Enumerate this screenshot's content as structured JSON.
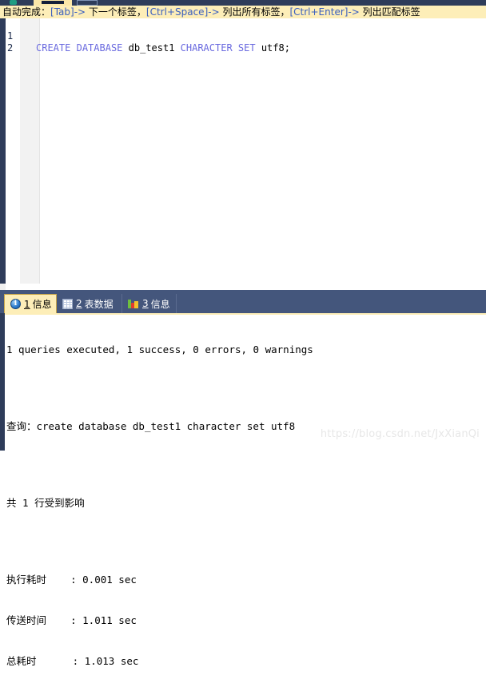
{
  "toolbar": {
    "icon_plus": "plus-green-icon",
    "tab_active_label": "",
    "box_label": ""
  },
  "hint_bar": {
    "prefix": "自动完成：",
    "items": [
      {
        "key": "[Tab]->",
        "text": " 下一个标签，"
      },
      {
        "key": "[Ctrl+Space]->",
        "text": " 列出所有标签，"
      },
      {
        "key": "[Ctrl+Enter]->",
        "text": " 列出匹配标签"
      }
    ],
    "key_color": "#3a5fbf"
  },
  "editor": {
    "lines": [
      {
        "number": "1",
        "tokens": [
          {
            "text": "CREATE",
            "type": "keyword"
          },
          {
            "text": " ",
            "type": "plain"
          },
          {
            "text": "DATABASE",
            "type": "keyword"
          },
          {
            "text": " db_test1 ",
            "type": "plain"
          },
          {
            "text": "CHARACTER",
            "type": "keyword"
          },
          {
            "text": " ",
            "type": "plain"
          },
          {
            "text": "SET",
            "type": "keyword"
          },
          {
            "text": " utf8;",
            "type": "plain"
          }
        ]
      },
      {
        "number": "2",
        "tokens": []
      }
    ],
    "keyword_color": "#6a6adf",
    "text_color": "#000000"
  },
  "result_tabs": [
    {
      "num": "1",
      "label": "信息",
      "icon": "info-icon",
      "active": true
    },
    {
      "num": "2",
      "label": "表数据",
      "icon": "table-grid-icon",
      "active": false
    },
    {
      "num": "3",
      "label": "信息",
      "icon": "colored-bars-icon",
      "active": false
    }
  ],
  "result_output": {
    "lines": [
      "1 queries executed, 1 success, 0 errors, 0 warnings",
      "",
      "查询：create database db_test1 character set utf8",
      "",
      "共 1 行受到影响",
      "",
      "执行耗时    : 0.001 sec",
      "传送时间    : 1.011 sec",
      "总耗时      : 1.013 sec"
    ]
  },
  "watermark": {
    "text": "https://blog.csdn.net/JxXianQi"
  }
}
